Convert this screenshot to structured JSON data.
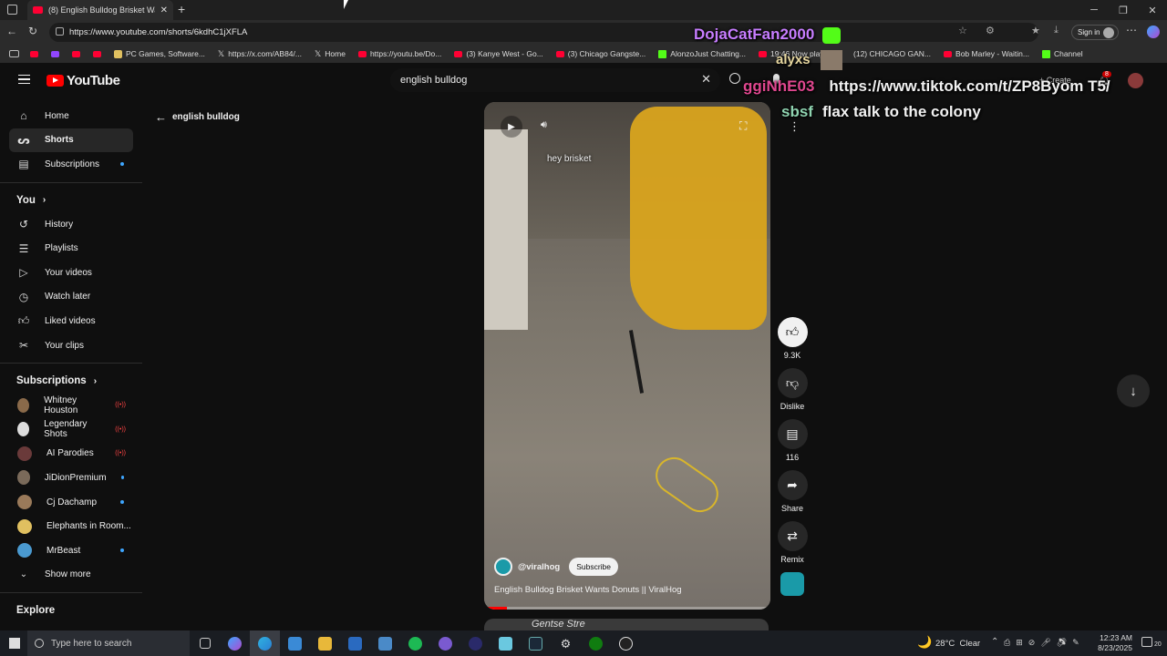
{
  "browser": {
    "tab_title": "(8) English Bulldog Brisket Wants",
    "url": "https://www.youtube.com/shorts/6kdhC1jXFLA",
    "sign_in": "Sign in",
    "bookmarks": [
      "PC Games, Software...",
      "https://x.com/AB84/...",
      "Home",
      "https://youtu.be/Do...",
      "(3) Kanye West - Go...",
      "(3) Chicago Gangste...",
      "AlonzoJust Chatting...",
      "19:46 Now playing...",
      "(12) CHICAGO GAN...",
      "Bob Marley - Waitin...",
      "Channel"
    ]
  },
  "youtube": {
    "logo": "YouTube",
    "search_value": "english bulldog",
    "back_label": "english bulldog",
    "create": "Create",
    "notif_count": "8"
  },
  "sidebar": {
    "main": [
      {
        "label": "Home",
        "icon": "home-icon"
      },
      {
        "label": "Shorts",
        "icon": "shorts-icon"
      },
      {
        "label": "Subscriptions",
        "icon": "subscriptions-icon"
      }
    ],
    "you_header": "You",
    "you": [
      {
        "label": "History",
        "icon": "history-icon"
      },
      {
        "label": "Playlists",
        "icon": "playlists-icon"
      },
      {
        "label": "Your videos",
        "icon": "your-videos-icon"
      },
      {
        "label": "Watch later",
        "icon": "watch-later-icon"
      },
      {
        "label": "Liked videos",
        "icon": "liked-videos-icon"
      },
      {
        "label": "Your clips",
        "icon": "clips-icon"
      }
    ],
    "subs_header": "Subscriptions",
    "subs": [
      {
        "label": "Whitney Houston",
        "badge": "live",
        "color": "#8a6a4a"
      },
      {
        "label": "Legendary Shots",
        "badge": "live",
        "color": "#dddddd"
      },
      {
        "label": "AI Parodies",
        "badge": "live",
        "color": "#6a3a3a"
      },
      {
        "label": "JiDionPremium",
        "badge": "dot",
        "color": "#7a6a5a"
      },
      {
        "label": "Cj Dachamp",
        "badge": "dot",
        "color": "#9a7a5a"
      },
      {
        "label": "Elephants in Room...",
        "badge": "none",
        "color": "#e0c060"
      },
      {
        "label": "MrBeast",
        "badge": "dot",
        "color": "#4a9ad0"
      }
    ],
    "show_more": "Show more",
    "explore": "Explore"
  },
  "short": {
    "caption": "hey brisket",
    "channel": "@viralhog",
    "subscribe": "Subscribe",
    "title": "English Bulldog Brisket Wants Donuts || ViralHog",
    "likes": "9.3K",
    "dislike": "Dislike",
    "comments": "116",
    "share": "Share",
    "remix": "Remix",
    "next_title": "Gentse Stre"
  },
  "overlay": {
    "streamer": "DojaCatFan2000",
    "chat": [
      {
        "user": "alyxs",
        "msg": "",
        "color": "#e8d8a0"
      },
      {
        "user": "ggiNhE03",
        "msg": "https://www.tiktok.com/t/ZP8Byom T5/",
        "color": "#e0478f"
      },
      {
        "user": "sbsf",
        "msg": "flax talk to the colony",
        "color": "#8fd3b0"
      }
    ]
  },
  "taskbar": {
    "search_placeholder": "Type here to search",
    "weather": "28°C  Clear",
    "time": "12:23 AM",
    "date": "8/23/2025",
    "notif": "20"
  }
}
